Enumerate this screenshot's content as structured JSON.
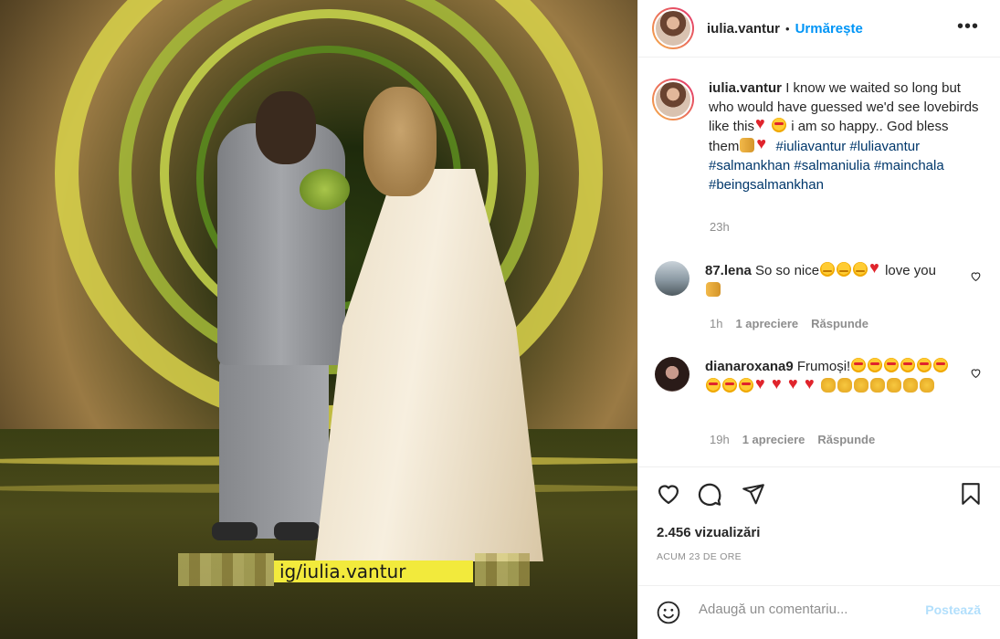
{
  "post": {
    "author": "iulia.vantur",
    "follow_label": "Urmărește",
    "separator": "•",
    "more_label": "•••",
    "media_watermark": "ig/iulia.vantur"
  },
  "caption": {
    "username": "iulia.vantur",
    "text_part1": " I know we waited so long but who would have guessed we'd see lovebirds like this",
    "text_part2": " i am so happy.. God bless them",
    "hashtags": [
      "#iuliavantur",
      "#luliavantur",
      "#salmankhan",
      "#salmaniulia",
      "#mainchala",
      "#beingsalmankhan"
    ],
    "time": "23h"
  },
  "comments": [
    {
      "username": "87.lena",
      "text_before": " So so nice",
      "text_mid": "love you",
      "time": "1h",
      "likes": "1 apreciere",
      "reply": "Răspunde"
    },
    {
      "username": "dianaroxana9",
      "text_before": " Frumoși!",
      "time": "19h",
      "likes": "1 apreciere",
      "reply": "Răspunde"
    }
  ],
  "actions": {
    "icons": [
      "heart-icon",
      "comment-icon",
      "share-icon",
      "bookmark-icon"
    ]
  },
  "stats": {
    "views": "2.456 vizualizări",
    "posted": "ACUM 23 DE ORE"
  },
  "add_comment": {
    "placeholder": "Adaugă un comentariu...",
    "post_label": "Postează"
  },
  "colors": {
    "accent": "#0095f6",
    "hashtag": "#00376b",
    "secondary_text": "#8e8e8e",
    "disabled_post": "#b2dffc"
  }
}
